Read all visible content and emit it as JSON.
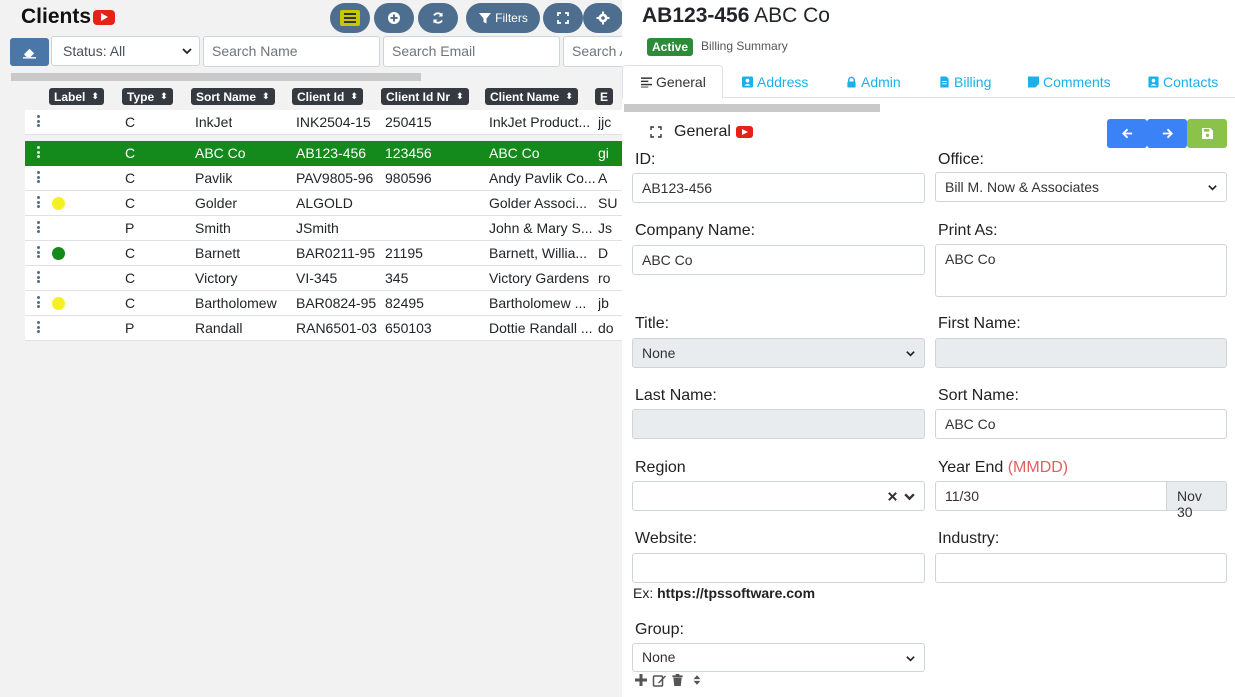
{
  "left": {
    "title": "Clients",
    "status_filter": "Status: All",
    "search_name_placeholder": "Search Name",
    "search_email_placeholder": "Search Email",
    "search_other_placeholder": "Search A",
    "filters_label": "Filters",
    "columns": [
      "Label",
      "Type",
      "Sort Name",
      "Client Id",
      "Client Id Nr",
      "Client Name",
      "E"
    ],
    "rows": [
      {
        "label": "",
        "type": "C",
        "sort": "InkJet",
        "cid": "INK2504-15",
        "cnr": "250415",
        "cname": "InkJet Product...",
        "email": "jjc"
      },
      {
        "label": "",
        "type": "C",
        "sort": "ABC Co",
        "cid": "AB123-456",
        "cnr": "123456",
        "cname": "ABC Co",
        "email": "gi",
        "selected": true
      },
      {
        "label": "",
        "type": "C",
        "sort": "Pavlik",
        "cid": "PAV9805-96",
        "cnr": "980596",
        "cname": "Andy Pavlik Co...",
        "email": "A"
      },
      {
        "label": "yellow",
        "type": "C",
        "sort": "Golder",
        "cid": "ALGOLD",
        "cnr": "",
        "cname": "Golder Associ...",
        "email": "SU"
      },
      {
        "label": "",
        "type": "P",
        "sort": "Smith",
        "cid": "JSmith",
        "cnr": "",
        "cname": "John & Mary S...",
        "email": "Js"
      },
      {
        "label": "green",
        "type": "C",
        "sort": "Barnett",
        "cid": "BAR0211-95",
        "cnr": "21195",
        "cname": "Barnett, Willia...",
        "email": "D"
      },
      {
        "label": "",
        "type": "C",
        "sort": "Victory",
        "cid": "VI-345",
        "cnr": "345",
        "cname": "Victory Gardens",
        "email": "ro"
      },
      {
        "label": "yellow",
        "type": "C",
        "sort": "Bartholomew",
        "cid": "BAR0824-95",
        "cnr": "82495",
        "cname": "Bartholomew ...",
        "email": "jb"
      },
      {
        "label": "",
        "type": "P",
        "sort": "Randall",
        "cid": "RAN6501-03",
        "cnr": "650103",
        "cname": "Dottie Randall ...",
        "email": "do"
      }
    ]
  },
  "right": {
    "client_id": "AB123-456",
    "client_name": "ABC Co",
    "status_badge": "Active",
    "billing_summary": "Billing Summary",
    "tabs": [
      "General",
      "Address",
      "Admin",
      "Billing",
      "Comments",
      "Contacts"
    ],
    "section_title": "General",
    "form": {
      "id_label": "ID:",
      "id_value": "AB123-456",
      "office_label": "Office:",
      "office_value": "Bill M. Now & Associates",
      "company_label": "Company Name:",
      "company_value": "ABC Co",
      "printas_label": "Print As:",
      "printas_value": "ABC Co",
      "title_label": "Title:",
      "title_value": "None",
      "firstname_label": "First Name:",
      "firstname_value": "",
      "lastname_label": "Last Name:",
      "lastname_value": "",
      "sortname_label": "Sort Name:",
      "sortname_value": "ABC Co",
      "region_label": "Region",
      "region_value": "",
      "yearend_label": "Year End",
      "yearend_hint": "(MMDD)",
      "yearend_value": "11/30",
      "yearend_addon": "Nov 30",
      "website_label": "Website:",
      "website_value": "",
      "website_hint_prefix": "Ex: ",
      "website_hint_example": "https://tpssoftware.com",
      "industry_label": "Industry:",
      "industry_value": "",
      "group_label": "Group:",
      "group_value": "None"
    }
  },
  "colors": {
    "accent": "#1ab0e8",
    "toolbar": "#4d6e8e",
    "selected_row": "#138a1b",
    "active_badge": "#2e8b3a",
    "nav_blue": "#3b82f6",
    "save_green": "#8bc34a"
  }
}
